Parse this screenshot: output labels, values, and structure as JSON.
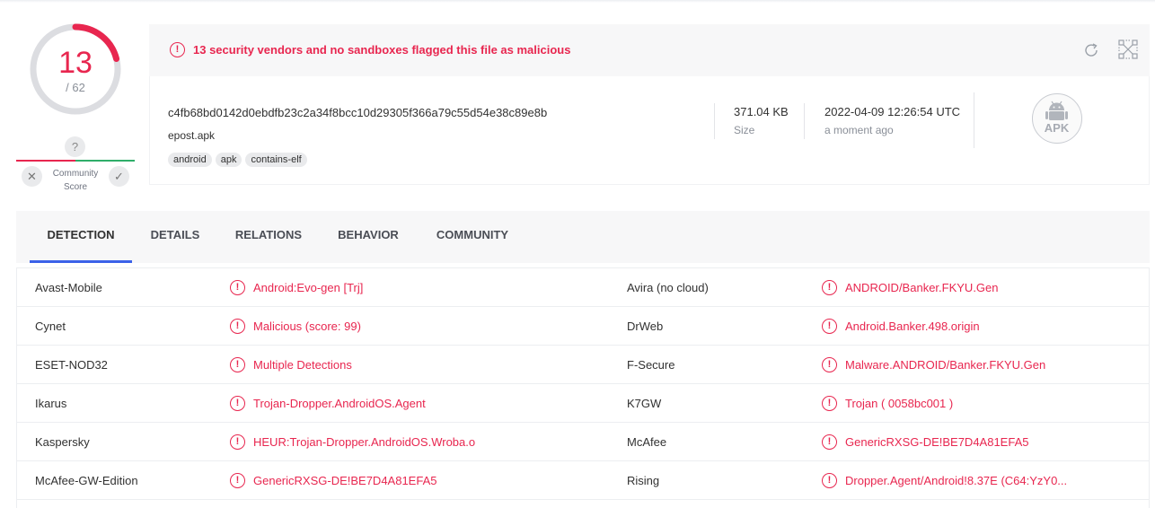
{
  "score": {
    "detections": "13",
    "total": "/ 62",
    "accent": "#e8264f",
    "fraction": 0.21
  },
  "community": {
    "question": "?",
    "label_line1": "Community",
    "label_line2": "Score",
    "down": "✕",
    "up": "✓"
  },
  "banner": {
    "icon": "!",
    "text": "13 security vendors and no sandboxes flagged this file as malicious",
    "reanalyze_icon": "reanalyze-icon",
    "similar_icon": "similar-files-icon"
  },
  "file": {
    "sha256": "c4fb68bd0142d0ebdfb23c2a34f8bcc10d29305f366a79c55d54e38c89e8b",
    "name": "epost.apk",
    "tags": [
      "android",
      "apk",
      "contains-elf"
    ],
    "size_value": "371.04 KB",
    "size_label": "Size",
    "date_value": "2022-04-09 12:26:54 UTC",
    "date_label": "a moment ago",
    "type_label": "APK"
  },
  "tabs": [
    "DETECTION",
    "DETAILS",
    "RELATIONS",
    "BEHAVIOR",
    "COMMUNITY"
  ],
  "detections": [
    {
      "vendor_left": "Avast-Mobile",
      "result_left": "Android:Evo-gen [Trj]",
      "vendor_right": "Avira (no cloud)",
      "result_right": "ANDROID/Banker.FKYU.Gen"
    },
    {
      "vendor_left": "Cynet",
      "result_left": "Malicious (score: 99)",
      "vendor_right": "DrWeb",
      "result_right": "Android.Banker.498.origin"
    },
    {
      "vendor_left": "ESET-NOD32",
      "result_left": "Multiple Detections",
      "vendor_right": "F-Secure",
      "result_right": "Malware.ANDROID/Banker.FKYU.Gen"
    },
    {
      "vendor_left": "Ikarus",
      "result_left": "Trojan-Dropper.AndroidOS.Agent",
      "vendor_right": "K7GW",
      "result_right": "Trojan ( 0058bc001 )"
    },
    {
      "vendor_left": "Kaspersky",
      "result_left": "HEUR:Trojan-Dropper.AndroidOS.Wroba.o",
      "vendor_right": "McAfee",
      "result_right": "GenericRXSG-DE!BE7D4A81EFA5"
    },
    {
      "vendor_left": "McAfee-GW-Edition",
      "result_left": "GenericRXSG-DE!BE7D4A81EFA5",
      "vendor_right": "Rising",
      "result_right": "Dropper.Agent/Android!8.37E (C64:YzY0..."
    }
  ]
}
